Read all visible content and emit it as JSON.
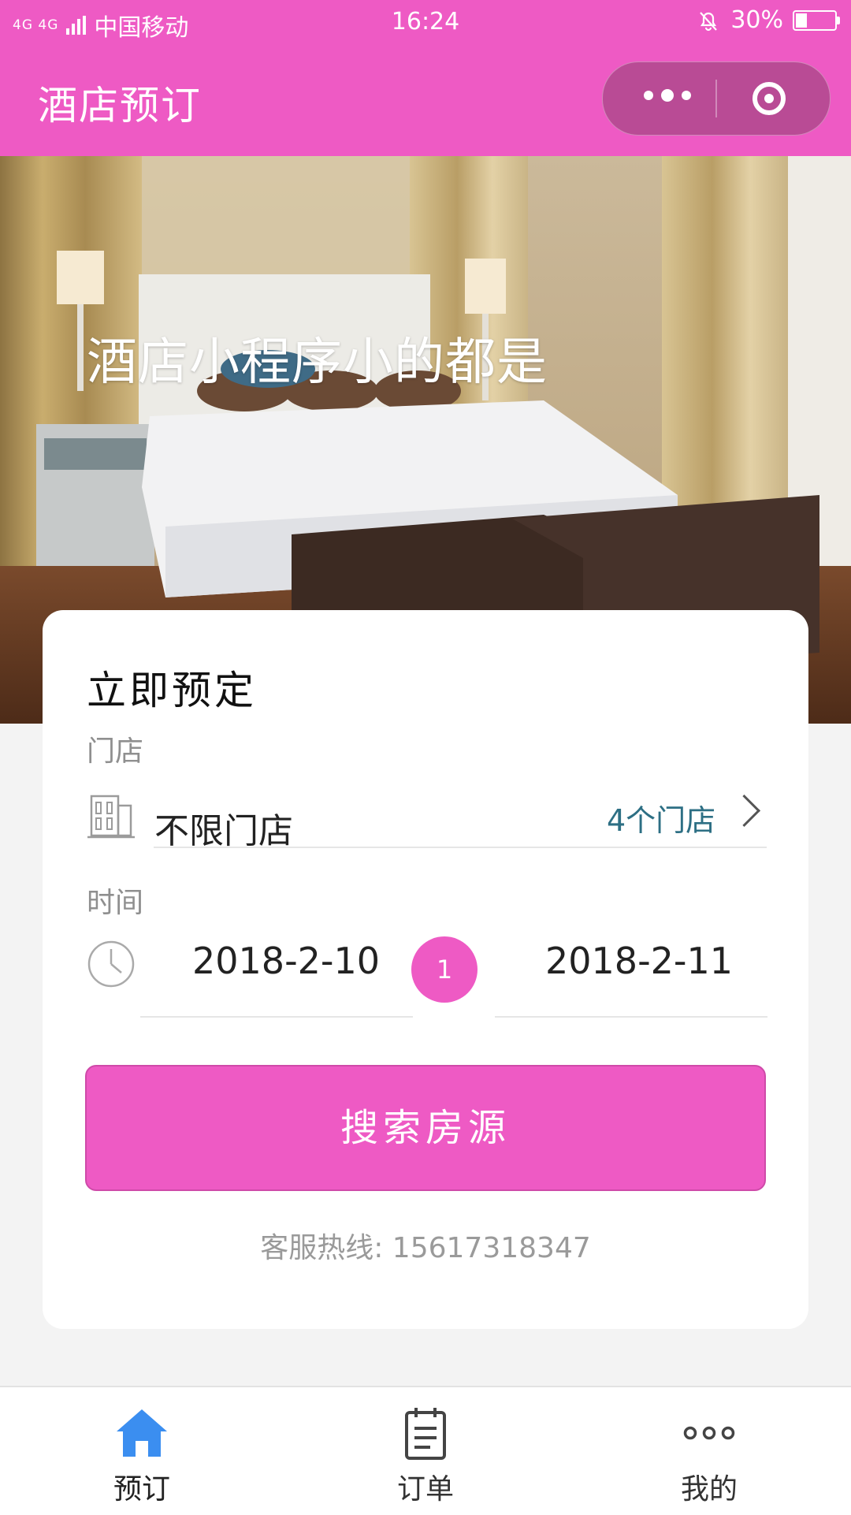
{
  "status_bar": {
    "network": "4G 4G",
    "carrier": "中国移动",
    "time": "16:24",
    "battery": "30%",
    "battery_level": 0.3
  },
  "nav": {
    "title": "酒店预订",
    "more_icon": "more-dots-icon",
    "close_icon": "target-circle-icon"
  },
  "hero": {
    "caption": "酒店小程序小的都是"
  },
  "booking": {
    "title": "立即预定",
    "store_label": "门店",
    "store_value": "不限门店",
    "store_count": "4个门店",
    "time_label": "时间",
    "check_in": "2018-2-10",
    "nights": "1",
    "check_out": "2018-2-11",
    "search_button": "搜索房源",
    "hotline": "客服热线: 15617318347"
  },
  "tabbar": {
    "items": [
      {
        "label": "预订",
        "icon": "home-icon",
        "active": true
      },
      {
        "label": "订单",
        "icon": "clipboard-icon",
        "active": false
      },
      {
        "label": "我的",
        "icon": "more-dots-icon",
        "active": false
      }
    ]
  },
  "colors": {
    "brand": "#ee5ac4",
    "tab_active": "#3b8ef0",
    "store_count": "#2d6f84"
  }
}
